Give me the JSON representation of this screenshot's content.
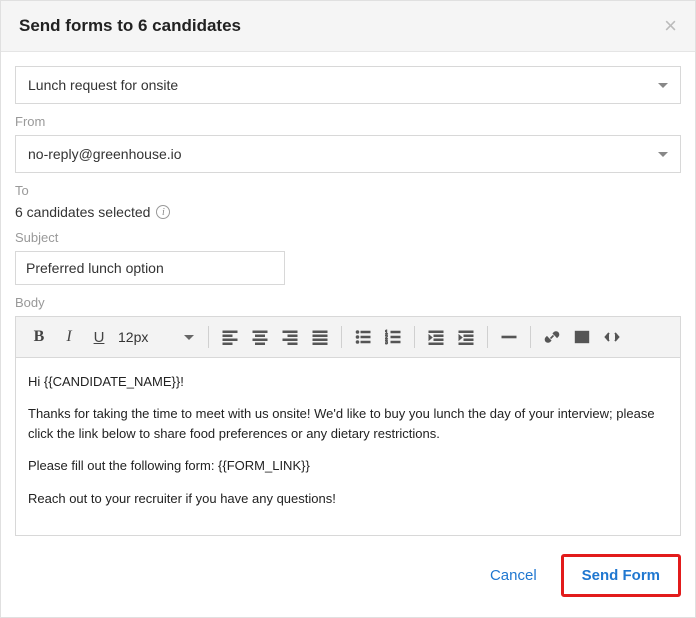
{
  "header": {
    "title": "Send forms to 6 candidates",
    "close": "×"
  },
  "template_select": {
    "value": "Lunch request for onsite"
  },
  "from": {
    "label": "From",
    "value": "no-reply@greenhouse.io"
  },
  "to": {
    "label": "To",
    "value": "6 candidates selected"
  },
  "subject": {
    "label": "Subject",
    "value": "Preferred lunch option"
  },
  "body": {
    "label": "Body",
    "toolbar": {
      "font_size": "12px"
    },
    "content": {
      "p1": "Hi {{CANDIDATE_NAME}}!",
      "p2": "Thanks for taking the time to meet with us onsite! We'd like to buy you lunch the day of your interview; please click the link below to share food preferences or any dietary restrictions.",
      "p3": "Please fill out the following form: {{FORM_LINK}}",
      "p4": "Reach out to your recruiter if you have any questions!"
    }
  },
  "footer": {
    "cancel": "Cancel",
    "send": "Send Form"
  }
}
